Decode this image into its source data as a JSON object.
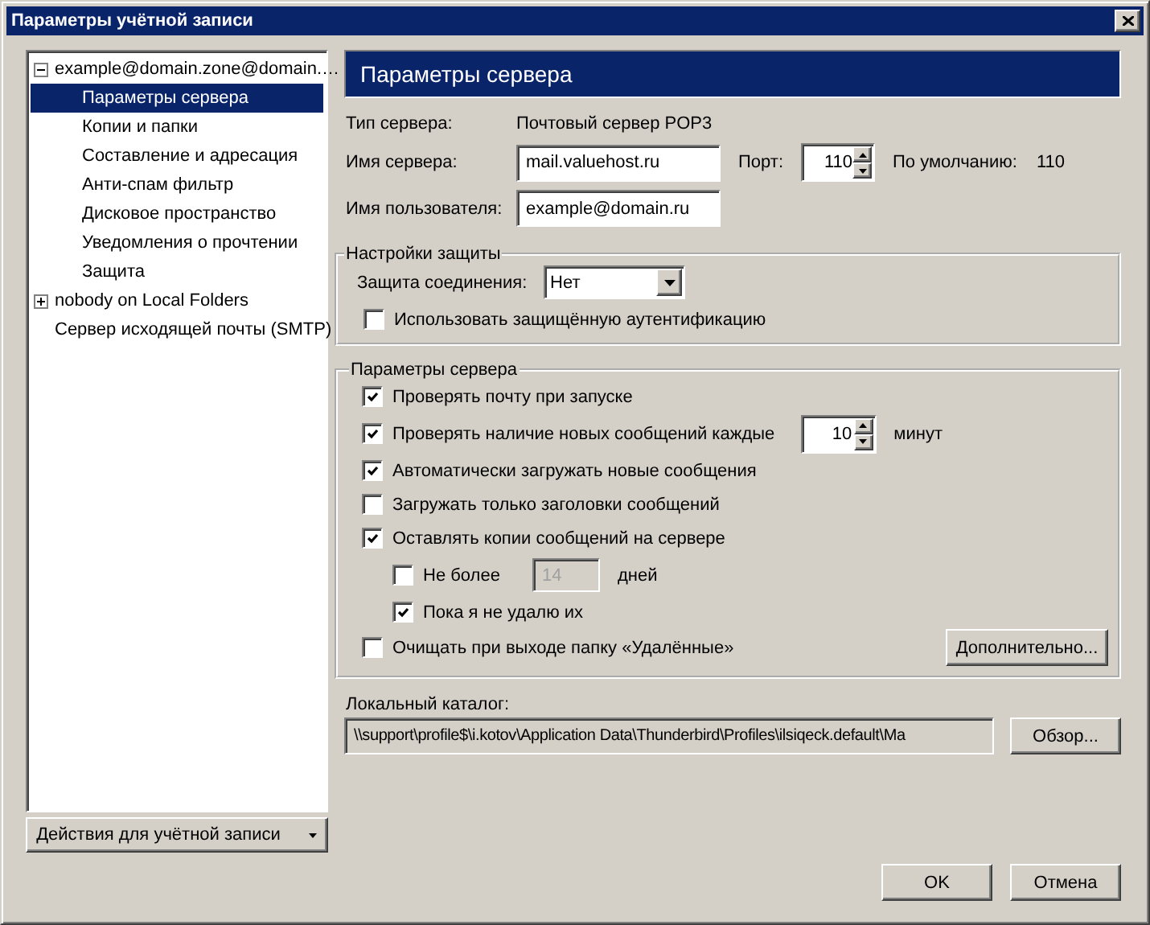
{
  "window": {
    "title": "Параметры учётной записи"
  },
  "tree": [
    {
      "label": "example@domain.zone@domain.…",
      "expanded": true,
      "selected": false,
      "children": [
        {
          "label": "Параметры сервера",
          "selected": true
        },
        {
          "label": "Копии и папки",
          "selected": false
        },
        {
          "label": "Составление и адресация",
          "selected": false
        },
        {
          "label": "Анти-спам фильтр",
          "selected": false
        },
        {
          "label": "Дисковое пространство",
          "selected": false
        },
        {
          "label": "Уведомления о прочтении",
          "selected": false
        },
        {
          "label": "Защита",
          "selected": false
        }
      ]
    },
    {
      "label": "nobody on Local Folders",
      "expanded": false,
      "selected": false
    },
    {
      "label": "Сервер исходящей почты (SMTP)",
      "selected": false
    }
  ],
  "account_actions_button": "Действия для учётной записи",
  "header": "Параметры сервера",
  "server": {
    "type_label": "Тип сервера:",
    "type_value": "Почтовый сервер POP3",
    "name_label": "Имя сервера:",
    "name_value": "mail.valuehost.ru",
    "port_label": "Порт:",
    "port_value": "110",
    "default_label": "По умолчанию:",
    "default_value": "110",
    "user_label": "Имя пользователя:",
    "user_value": "example@domain.ru"
  },
  "security": {
    "title": "Настройки защиты",
    "connection_label": "Защита соединения:",
    "connection_value": "Нет",
    "secure_auth": {
      "label": "Использовать защищённую аутентификацию",
      "checked": false
    }
  },
  "server_settings": {
    "title": "Параметры сервера",
    "options": [
      {
        "kind": "check",
        "label": "Проверять почту при запуске",
        "checked": true
      },
      {
        "kind": "spin",
        "label": "Проверять наличие новых сообщений каждые",
        "checked": true,
        "value": "10",
        "suffix": "минут"
      },
      {
        "kind": "check",
        "label": "Автоматически загружать новые сообщения",
        "checked": true
      },
      {
        "kind": "check",
        "label": "Загружать только заголовки сообщений",
        "checked": false
      },
      {
        "kind": "check",
        "label": "Оставлять копии сообщений на сервере",
        "checked": true,
        "children": [
          {
            "kind": "field",
            "label": "Не более",
            "checked": false,
            "value": "14",
            "disabled": true,
            "suffix": "дней"
          },
          {
            "kind": "check",
            "label": "Пока я не удалю их",
            "checked": true
          }
        ]
      },
      {
        "kind": "check",
        "label": "Очищать при выходе папку «Удалённые»",
        "checked": false
      }
    ],
    "advanced_button": "Дополнительно..."
  },
  "local_dir": {
    "label": "Локальный каталог:",
    "value": "\\\\support\\profile$\\i.kotov\\Application Data\\Thunderbird\\Profiles\\ilsiqeck.default\\Ma",
    "browse_button": "Обзор..."
  },
  "buttons": [
    "OK",
    "Отмена"
  ]
}
